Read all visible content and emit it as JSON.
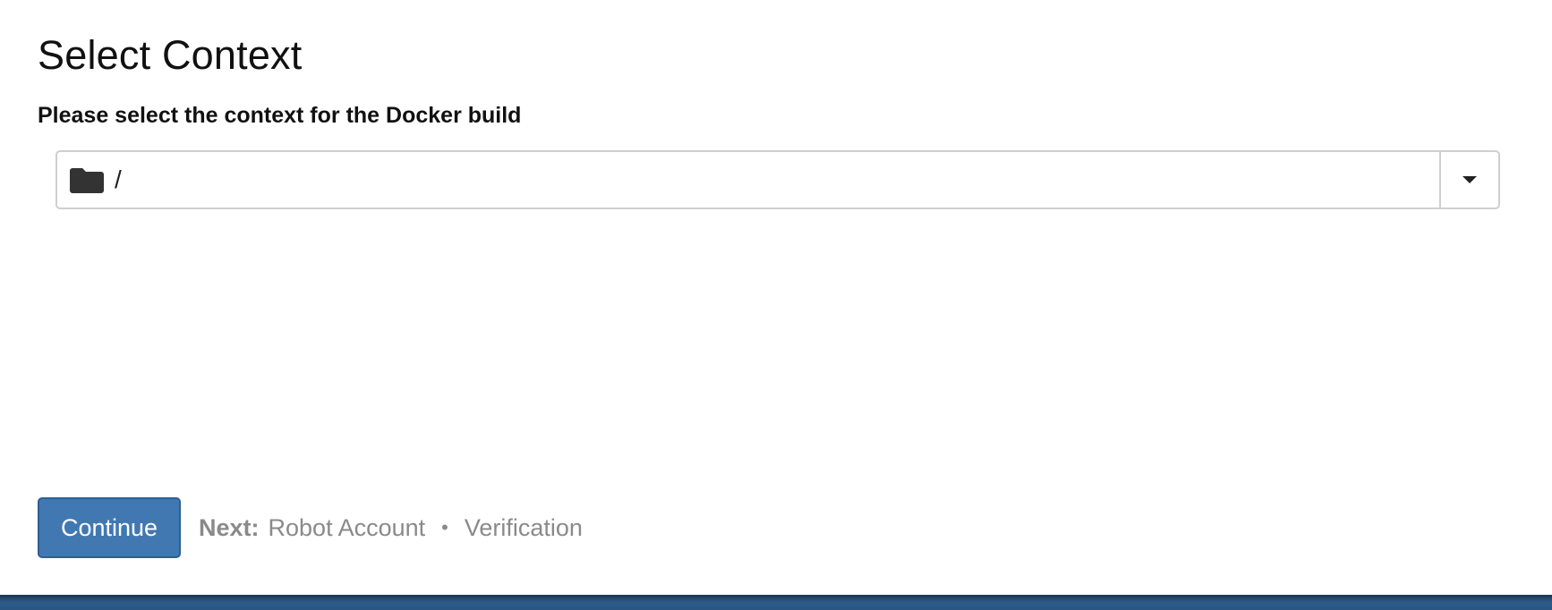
{
  "page": {
    "title": "Select Context",
    "instruction": "Please select the context for the Docker build"
  },
  "context_select": {
    "icon": "folder-icon",
    "value": "/"
  },
  "actions": {
    "continue_label": "Continue"
  },
  "next_steps": {
    "label": "Next:",
    "steps": [
      "Robot Account",
      "Verification"
    ],
    "separator": "•"
  },
  "colors": {
    "primary_button": "#4178b1",
    "footer": "#2b5684",
    "muted_text": "#8a8a8a"
  }
}
